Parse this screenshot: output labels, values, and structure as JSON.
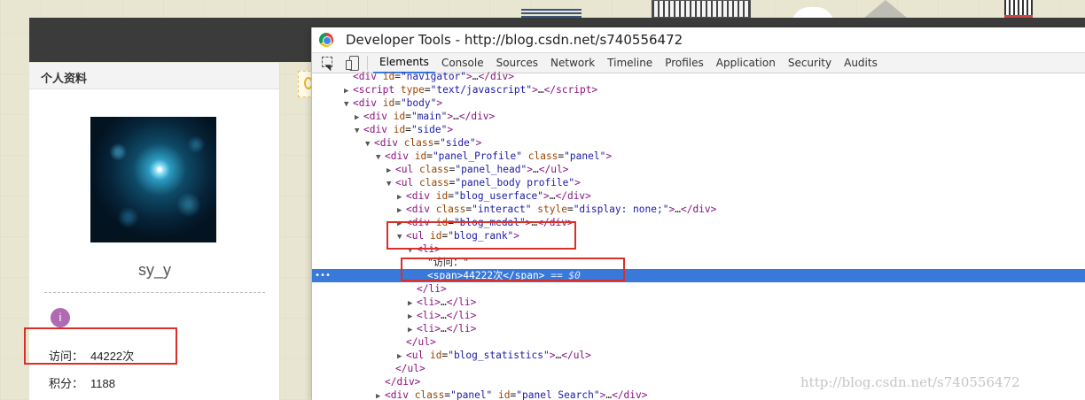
{
  "sidebar": {
    "panel_title": "个人资料",
    "username": "sy_y",
    "medal_glyph": "i",
    "stats": [
      {
        "label": "访问：",
        "value": "44222次"
      },
      {
        "label": "积分：",
        "value": "1188"
      }
    ]
  },
  "devtools": {
    "title": "Developer Tools - http://blog.csdn.net/s740556472",
    "tabs": [
      "Elements",
      "Console",
      "Sources",
      "Network",
      "Timeline",
      "Profiles",
      "Application",
      "Security",
      "Audits"
    ],
    "active_tab": "Elements",
    "dom_lines": [
      {
        "indent": 3,
        "tri": "",
        "html": "<span class=\"tag\">&lt;div</span> <span class=\"an\">id</span>=<span class=\"av\">\"navigator\"</span><span class=\"tag\">&gt;</span>…<span class=\"tag\">&lt;/div&gt;</span>"
      },
      {
        "indent": 3,
        "tri": "▶",
        "html": "<span class=\"tag\">&lt;script</span> <span class=\"an\">type</span>=<span class=\"av\">\"text/javascript\"</span><span class=\"tag\">&gt;</span>…<span class=\"tag\">&lt;/script&gt;</span>"
      },
      {
        "indent": 3,
        "tri": "▼",
        "html": "<span class=\"tag\">&lt;div</span> <span class=\"an\">id</span>=<span class=\"av\">\"body\"</span><span class=\"tag\">&gt;</span>"
      },
      {
        "indent": 4,
        "tri": "▶",
        "html": "<span class=\"tag\">&lt;div</span> <span class=\"an\">id</span>=<span class=\"av\">\"main\"</span><span class=\"tag\">&gt;</span>…<span class=\"tag\">&lt;/div&gt;</span>"
      },
      {
        "indent": 4,
        "tri": "▼",
        "html": "<span class=\"tag\">&lt;div</span> <span class=\"an\">id</span>=<span class=\"av\">\"side\"</span><span class=\"tag\">&gt;</span>"
      },
      {
        "indent": 5,
        "tri": "▼",
        "html": "<span class=\"tag\">&lt;div</span> <span class=\"an\">class</span>=<span class=\"av\">\"side\"</span><span class=\"tag\">&gt;</span>"
      },
      {
        "indent": 6,
        "tri": "▼",
        "html": "<span class=\"tag\">&lt;div</span> <span class=\"an\">id</span>=<span class=\"av\">\"panel_Profile\"</span> <span class=\"an\">class</span>=<span class=\"av\">\"panel\"</span><span class=\"tag\">&gt;</span>"
      },
      {
        "indent": 7,
        "tri": "▶",
        "html": "<span class=\"tag\">&lt;ul</span> <span class=\"an\">class</span>=<span class=\"av\">\"panel_head\"</span><span class=\"tag\">&gt;</span>…<span class=\"tag\">&lt;/ul&gt;</span>"
      },
      {
        "indent": 7,
        "tri": "▼",
        "html": "<span class=\"tag\">&lt;ul</span> <span class=\"an\">class</span>=<span class=\"av\">\"panel_body profile\"</span><span class=\"tag\">&gt;</span>"
      },
      {
        "indent": 8,
        "tri": "▶",
        "html": "<span class=\"tag\">&lt;div</span> <span class=\"an\">id</span>=<span class=\"av\">\"blog_userface\"</span><span class=\"tag\">&gt;</span>…<span class=\"tag\">&lt;/div&gt;</span>"
      },
      {
        "indent": 8,
        "tri": "▶",
        "html": "<span class=\"tag\">&lt;div</span> <span class=\"an\">class</span>=<span class=\"av\">\"interact\"</span> <span class=\"an\">style</span>=<span class=\"av\">\"display: none;\"</span><span class=\"tag\">&gt;</span>…<span class=\"tag\">&lt;/div&gt;</span>"
      },
      {
        "indent": 8,
        "tri": "▶",
        "html": "<span class=\"tag\">&lt;div</span> <span class=\"an\">id</span>=<span class=\"av\">\"blog_medal\"</span><span class=\"tag\">&gt;</span>…<span class=\"tag\">&lt;/div&gt;</span>"
      },
      {
        "indent": 8,
        "tri": "▼",
        "html": "<span class=\"tag\">&lt;ul</span> <span class=\"an\">id</span>=<span class=\"av\">\"blog_rank\"</span><span class=\"tag\">&gt;</span>"
      },
      {
        "indent": 9,
        "tri": "▼",
        "html": "<span class=\"tag\">&lt;li&gt;</span>"
      },
      {
        "indent": 10,
        "tri": "",
        "html": "<span class=\"txt\">\"访问：\"</span>"
      },
      {
        "indent": 10,
        "tri": "",
        "sel": true,
        "html": "<span class=\"tag\">&lt;span&gt;</span><span class=\"txt\">44222次</span><span class=\"tag\">&lt;/span&gt;</span> <span class=\"eq\">== $0</span>"
      },
      {
        "indent": 9,
        "tri": "",
        "html": "<span class=\"tag\">&lt;/li&gt;</span>"
      },
      {
        "indent": 9,
        "tri": "▶",
        "html": "<span class=\"tag\">&lt;li&gt;</span>…<span class=\"tag\">&lt;/li&gt;</span>"
      },
      {
        "indent": 9,
        "tri": "▶",
        "html": "<span class=\"tag\">&lt;li&gt;</span>…<span class=\"tag\">&lt;/li&gt;</span>"
      },
      {
        "indent": 9,
        "tri": "▶",
        "html": "<span class=\"tag\">&lt;li&gt;</span>…<span class=\"tag\">&lt;/li&gt;</span>"
      },
      {
        "indent": 8,
        "tri": "",
        "html": "<span class=\"tag\">&lt;/ul&gt;</span>"
      },
      {
        "indent": 8,
        "tri": "▶",
        "html": "<span class=\"tag\">&lt;ul</span> <span class=\"an\">id</span>=<span class=\"av\">\"blog_statistics\"</span><span class=\"tag\">&gt;</span>…<span class=\"tag\">&lt;/ul&gt;</span>"
      },
      {
        "indent": 7,
        "tri": "",
        "html": "<span class=\"tag\">&lt;/ul&gt;</span>"
      },
      {
        "indent": 6,
        "tri": "",
        "html": "<span class=\"tag\">&lt;/div&gt;</span>"
      },
      {
        "indent": 6,
        "tri": "▶",
        "html": "<span class=\"tag\">&lt;div</span> <span class=\"an\">class</span>=<span class=\"av\">\"panel\"</span> <span class=\"an\">id</span>=<span class=\"av\">\"panel_Search\"</span><span class=\"tag\">&gt;</span>…<span class=\"tag\">&lt;/div&gt;</span>"
      }
    ]
  },
  "watermark": "http://blog.csdn.net/s740556472",
  "colors": {
    "highlight_box": "#d9302a",
    "selected_row": "#3879d9",
    "tag": "#881280",
    "attr_name": "#994500",
    "attr_value": "#1a1aa6"
  }
}
